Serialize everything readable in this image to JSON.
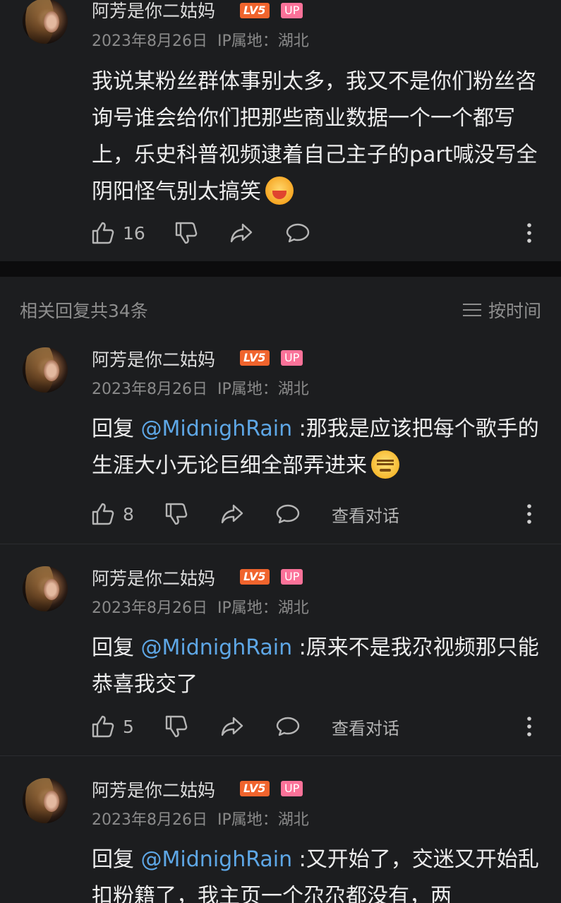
{
  "colors": {
    "background": "#1c1d1f",
    "mention": "#5ea7e6",
    "level_badge": "#f0642d",
    "up_badge": "#fb7299"
  },
  "main_comment": {
    "username": "阿芳是你二姑妈",
    "level_badge": "LV5",
    "up_badge": "UP",
    "date": "2023年8月26日",
    "ip_location": "IP属地：湖北",
    "text": "我说某粉丝群体事别太多，我又不是你们粉丝咨询号谁会给你们把那些商业数据一个一个都写上，乐史科普视频逮着自己主子的part喊没写全阴阳怪气别太搞笑",
    "emoji": "laughing-emoji",
    "likes": "16"
  },
  "replies_header": {
    "count_label": "相关回复共34条",
    "sort_label": "按时间"
  },
  "replies": [
    {
      "username": "阿芳是你二姑妈",
      "level_badge": "LV5",
      "up_badge": "UP",
      "date": "2023年8月26日",
      "ip_location": "IP属地：湖北",
      "reply_prefix": "回复 ",
      "mention": "@MidnighRain",
      "text": " :那我是应该把每个歌手的生涯大小无论巨细全部弄进来",
      "emoji": "smirk-emoji",
      "likes": "8",
      "view_conversation": "查看对话"
    },
    {
      "username": "阿芳是你二姑妈",
      "level_badge": "LV5",
      "up_badge": "UP",
      "date": "2023年8月26日",
      "ip_location": "IP属地：湖北",
      "reply_prefix": "回复 ",
      "mention": "@MidnighRain",
      "text": " :原来不是我尕视频那只能恭喜我交了",
      "likes": "5",
      "view_conversation": "查看对话"
    },
    {
      "username": "阿芳是你二姑妈",
      "level_badge": "LV5",
      "up_badge": "UP",
      "date": "2023年8月26日",
      "ip_location": "IP属地：湖北",
      "reply_prefix": "回复 ",
      "mention": "@MidnighRain",
      "text": " :又开始了，交迷又开始乱扣粉籍了，我主页一个尕尕都没有，两"
    }
  ]
}
